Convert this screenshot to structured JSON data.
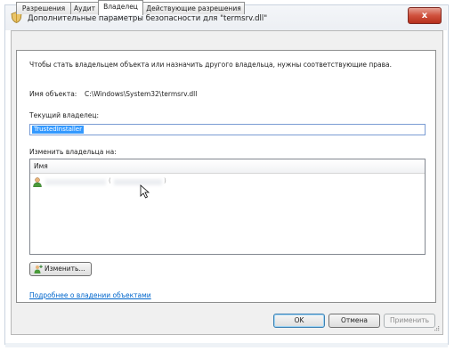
{
  "window": {
    "title": "Дополнительные параметры безопасности  для \"termsrv.dll\"",
    "close_label": "x"
  },
  "tabs": [
    {
      "label": "Разрешения",
      "active": false
    },
    {
      "label": "Аудит",
      "active": false
    },
    {
      "label": "Владелец",
      "active": true
    },
    {
      "label": "Действующие разрешения",
      "active": false
    }
  ],
  "owner_page": {
    "instruction": "Чтобы стать владельцем объекта или назначить другого владельца, нужны соответствующие права.",
    "object_name_label": "Имя объекта:",
    "object_name_value": "C:\\Windows\\System32\\termsrv.dll",
    "current_owner_label": "Текущий владелец:",
    "current_owner_value": "TrustedInstaller",
    "change_owner_label": "Изменить владельца на:",
    "list_header_name": "Имя",
    "list_rows": [
      {
        "name": "",
        "account": "(",
        "account_suffix": ")",
        "icon": "user-icon"
      }
    ],
    "change_button_label": "Изменить...",
    "learn_more_link": "Подробнее о владении объектами"
  },
  "buttons": {
    "ok": "OK",
    "cancel": "Отмена",
    "apply": "Применить"
  },
  "colors": {
    "selection": "#3399ff",
    "link": "#0066cc",
    "close_button": "#c9452f"
  }
}
